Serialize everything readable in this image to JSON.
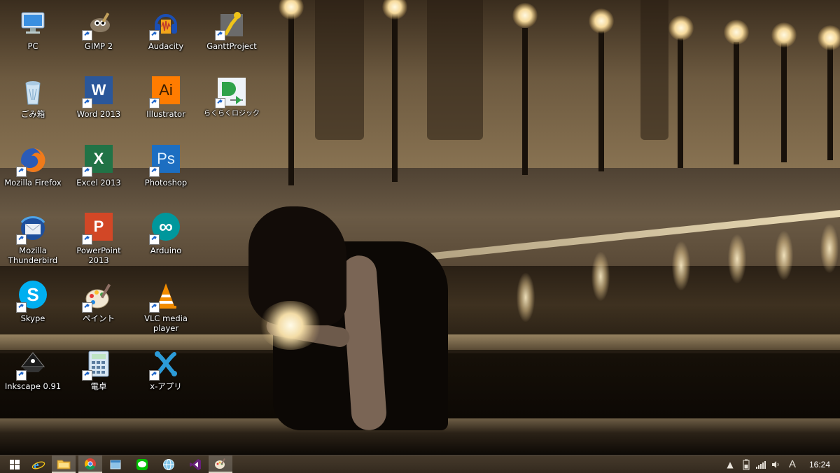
{
  "desktop": {
    "icons": [
      {
        "label": "PC",
        "icon": "computer-icon"
      },
      {
        "label": "GIMP 2",
        "icon": "gimp-icon"
      },
      {
        "label": "Audacity",
        "icon": "audacity-icon"
      },
      {
        "label": "GanttProject",
        "icon": "ganttproject-icon"
      },
      {
        "label": "ごみ箱",
        "icon": "recycle-bin-icon"
      },
      {
        "label": "Word 2013",
        "icon": "word-icon",
        "glyph": "W"
      },
      {
        "label": "Illustrator",
        "icon": "illustrator-icon",
        "glyph": "Ai"
      },
      {
        "label": "らくらくロジック",
        "icon": "logic-gate-icon"
      },
      {
        "label": "Mozilla Firefox",
        "icon": "firefox-icon"
      },
      {
        "label": "Excel 2013",
        "icon": "excel-icon",
        "glyph": "X"
      },
      {
        "label": "Photoshop",
        "icon": "photoshop-icon",
        "glyph": "Ps"
      },
      {
        "label": "Mozilla\nThunderbird",
        "icon": "thunderbird-icon"
      },
      {
        "label": "PowerPoint\n2013",
        "icon": "powerpoint-icon",
        "glyph": "P"
      },
      {
        "label": "Arduino",
        "icon": "arduino-icon",
        "glyph": "∞"
      },
      {
        "label": "Skype",
        "icon": "skype-icon",
        "glyph": "S"
      },
      {
        "label": "ペイント",
        "icon": "paint-icon"
      },
      {
        "label": "VLC media\nplayer",
        "icon": "vlc-icon"
      },
      {
        "label": "Inkscape 0.91",
        "icon": "inkscape-icon"
      },
      {
        "label": "電卓",
        "icon": "calculator-icon"
      },
      {
        "label": "x-アプリ",
        "icon": "x-app-icon"
      }
    ]
  },
  "taskbar": {
    "pinned": [
      {
        "name": "start-button",
        "icon": "windows-logo-icon"
      },
      {
        "name": "internet-explorer",
        "icon": "internet-explorer-icon"
      },
      {
        "name": "file-explorer",
        "icon": "folder-icon"
      },
      {
        "name": "chrome",
        "icon": "chrome-icon"
      },
      {
        "name": "app-generic",
        "icon": "app-window-icon"
      },
      {
        "name": "line",
        "icon": "line-icon"
      },
      {
        "name": "app-globe",
        "icon": "globe-app-icon"
      },
      {
        "name": "visual-studio",
        "icon": "visual-studio-icon"
      },
      {
        "name": "paint",
        "icon": "paint-icon"
      }
    ],
    "tray": {
      "ime": "A",
      "time": "16:24"
    }
  },
  "colors": {
    "word": "#2b579a",
    "excel": "#217346",
    "powerpoint": "#d24726",
    "illustrator": "#ff7c00",
    "photoshop": "#1c6ec1",
    "arduino": "#00979c",
    "skype": "#00aff0"
  }
}
